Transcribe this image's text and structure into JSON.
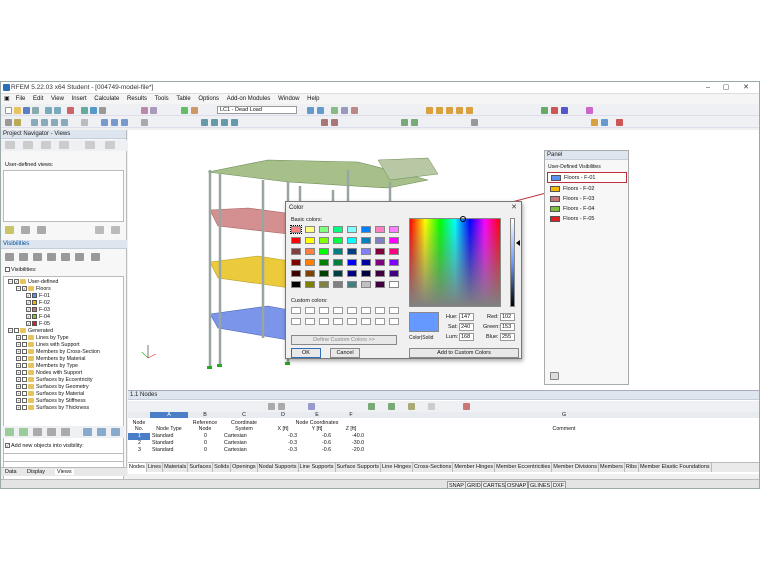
{
  "app": {
    "title": "RFEM 5.22.03 x64 Student - [004749-model-file*]"
  },
  "menu": [
    "File",
    "Edit",
    "View",
    "Insert",
    "Calculate",
    "Results",
    "Tools",
    "Table",
    "Options",
    "Add-on Modules",
    "Window",
    "Help"
  ],
  "toolbar": {
    "load_case": "LC1 - Dead Load"
  },
  "navigator": {
    "title": "Project Navigator - Views",
    "user_defined_views_label": "User-defined views:",
    "visibilities_title": "Visibilities",
    "visibilities_label": "Visibilities:",
    "tree": {
      "user_defined": "User-defined",
      "floors": "Floors",
      "floor_items": [
        "F-01",
        "F-02",
        "F-03",
        "F-04",
        "F-05"
      ],
      "generated": "Generated",
      "generated_items": [
        "Lines by Type",
        "Lines with Support",
        "Members by Cross-Section",
        "Members by Material",
        "Members by Type",
        "Nodes with Support",
        "Surfaces by Eccentricity",
        "Surfaces by Geometry",
        "Surfaces by Material",
        "Surfaces by Stiffness",
        "Surfaces by Thickness"
      ]
    },
    "add_objects_label": "Add new objects into visibility:",
    "tabs": [
      "Data",
      "Display",
      "Views"
    ]
  },
  "panel": {
    "title": "Panel",
    "subtitle": "User-Defined Visibilities",
    "items": [
      {
        "label": "Floors - F-01",
        "color": "#5b8ff0"
      },
      {
        "label": "Floors - F-02",
        "color": "#f5b800"
      },
      {
        "label": "Floors - F-03",
        "color": "#c87878"
      },
      {
        "label": "Floors - F-04",
        "color": "#80c040"
      },
      {
        "label": "Floors - F-05",
        "color": "#e02020"
      }
    ]
  },
  "color_dialog": {
    "title": "Color",
    "basic_colors_label": "Basic colors:",
    "custom_colors_label": "Custom colors:",
    "define_custom_label": "Define Custom Colors >>",
    "ok_label": "OK",
    "cancel_label": "Cancel",
    "colorsolid_label": "Color|Solid",
    "hue_label": "Hue:",
    "hue": "147",
    "sat_label": "Sat:",
    "sat": "240",
    "lum_label": "Lum:",
    "lum": "168",
    "red_label": "Red:",
    "red": "102",
    "green_label": "Green:",
    "green": "153",
    "blue_label": "Blue:",
    "blue": "255",
    "add_custom_label": "Add to Custom Colors",
    "basic_colors": [
      "#ff8080",
      "#ffff80",
      "#80ff80",
      "#00ff80",
      "#80ffff",
      "#0080ff",
      "#ff80c0",
      "#ff80ff",
      "#ff0000",
      "#ffff00",
      "#80ff00",
      "#00ff40",
      "#00ffff",
      "#0080c0",
      "#8080c0",
      "#ff00ff",
      "#804040",
      "#ff8040",
      "#00ff00",
      "#008080",
      "#004080",
      "#8080ff",
      "#800040",
      "#ff0080",
      "#800000",
      "#ff8000",
      "#008000",
      "#008040",
      "#0000ff",
      "#0000a0",
      "#800080",
      "#8000ff",
      "#400000",
      "#804000",
      "#004000",
      "#004040",
      "#000080",
      "#000040",
      "#400040",
      "#400080",
      "#000000",
      "#808000",
      "#808040",
      "#808080",
      "#408080",
      "#c0c0c0",
      "#400040",
      "#ffffff"
    ],
    "selected_color": "#6699ff"
  },
  "table": {
    "title": "1.1 Nodes",
    "col_letters": [
      "A",
      "B",
      "C",
      "D",
      "E",
      "F",
      "G"
    ],
    "headers": {
      "node_no": "Node No.",
      "node_type": "Node Type",
      "reference": "Reference Node",
      "coordinate": "Coordinate System",
      "node_coords": "Node Coordinates",
      "x": "X [ft]",
      "y": "Y [ft]",
      "z": "Z [ft]",
      "comment": "Comment"
    },
    "rows": [
      [
        "1",
        "Standard",
        "0",
        "Cartesian",
        "-0.3",
        "-0.6",
        "-40.0"
      ],
      [
        "2",
        "Standard",
        "0",
        "Cartesian",
        "-0.3",
        "-0.6",
        "-30.0"
      ],
      [
        "3",
        "Standard",
        "0",
        "Cartesian",
        "-0.3",
        "-0.6",
        "-20.0"
      ]
    ],
    "tabs": [
      "Nodes",
      "Lines",
      "Materials",
      "Surfaces",
      "Solids",
      "Openings",
      "Nodal Supports",
      "Line Supports",
      "Surface Supports",
      "Line Hinges",
      "Cross-Sections",
      "Member Hinges",
      "Member Eccentricities",
      "Member Divisions",
      "Members",
      "Ribs",
      "Member Elastic Foundations"
    ]
  },
  "statusbar": [
    "SNAP",
    "GRID",
    "CARTES",
    "OSNAP",
    "GLINES",
    "DXF"
  ]
}
